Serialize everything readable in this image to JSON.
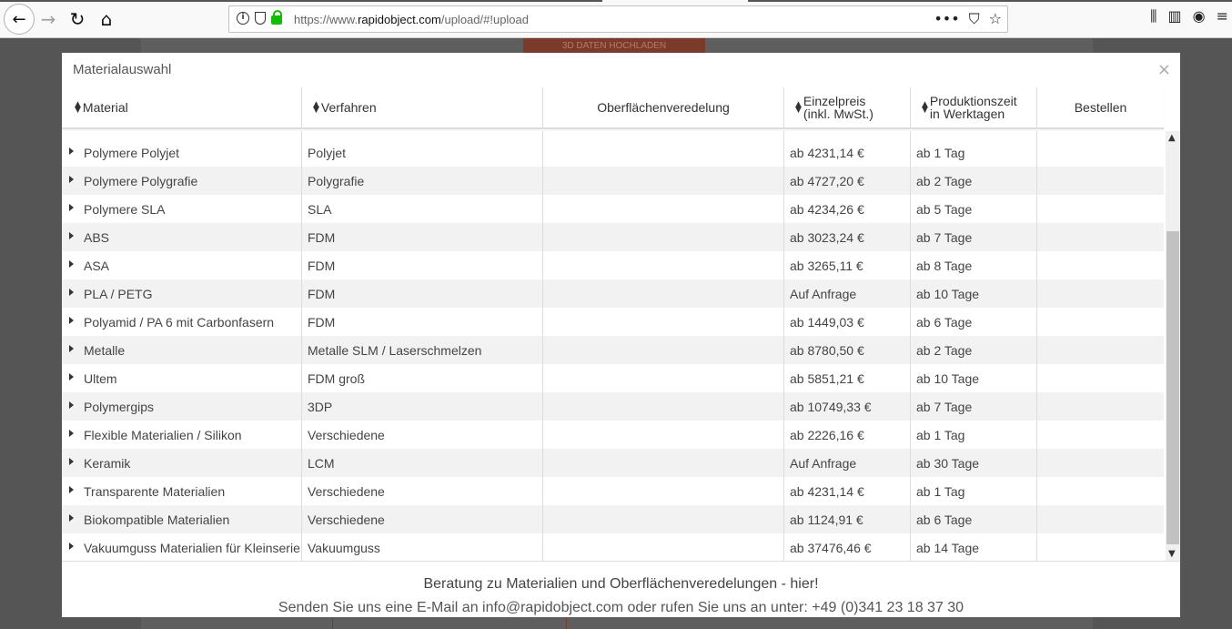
{
  "browser": {
    "url_prefix": "https://www.",
    "url_domain": "rapidobject.com",
    "url_path": "/upload/#!upload"
  },
  "background": {
    "upload_button": "3D DATEN HOCHLADEN"
  },
  "modal": {
    "title": "Materialauswahl",
    "close": "×"
  },
  "table": {
    "columns": {
      "material": "Material",
      "verfahren": "Verfahren",
      "oberflaeche": "Oberflächenveredelung",
      "einzelpreis_line1": "Einzelpreis",
      "einzelpreis_line2": "(inkl. MwSt.)",
      "produktion_line1": "Produktionszeit",
      "produktion_line2": "in Werktagen",
      "bestellen": "Bestellen"
    },
    "rows": [
      {
        "material": "Polymere Polyjet",
        "verfahren": "Polyjet",
        "preis": "ab 4231,14 €",
        "zeit": "ab 1 Tag"
      },
      {
        "material": "Polymere Polygrafie",
        "verfahren": "Polygrafie",
        "preis": "ab 4727,20 €",
        "zeit": "ab 2 Tage"
      },
      {
        "material": "Polymere SLA",
        "verfahren": "SLA",
        "preis": "ab 4234,26 €",
        "zeit": "ab 5 Tage"
      },
      {
        "material": "ABS",
        "verfahren": "FDM",
        "preis": "ab 3023,24 €",
        "zeit": "ab 7 Tage"
      },
      {
        "material": "ASA",
        "verfahren": "FDM",
        "preis": "ab 3265,11 €",
        "zeit": "ab 8 Tage"
      },
      {
        "material": "PLA / PETG",
        "verfahren": "FDM",
        "preis": "Auf Anfrage",
        "zeit": "ab 10 Tage"
      },
      {
        "material": "Polyamid / PA 6 mit Carbonfasern",
        "verfahren": "FDM",
        "preis": "ab 1449,03 €",
        "zeit": "ab 6 Tage"
      },
      {
        "material": "Metalle",
        "verfahren": "Metalle SLM / Laserschmelzen",
        "preis": "ab 8780,50 €",
        "zeit": "ab 2 Tage"
      },
      {
        "material": "Ultem",
        "verfahren": "FDM groß",
        "preis": "ab 5851,21 €",
        "zeit": "ab 10 Tage"
      },
      {
        "material": "Polymergips",
        "verfahren": "3DP",
        "preis": "ab 10749,33 €",
        "zeit": "ab 7 Tage"
      },
      {
        "material": "Flexible Materialien / Silikon",
        "verfahren": "Verschiedene",
        "preis": "ab 2226,16 €",
        "zeit": "ab 1 Tag"
      },
      {
        "material": "Keramik",
        "verfahren": "LCM",
        "preis": "Auf Anfrage",
        "zeit": "ab 30 Tage"
      },
      {
        "material": "Transparente Materialien",
        "verfahren": "Verschiedene",
        "preis": "ab 4231,14 €",
        "zeit": "ab 1 Tag"
      },
      {
        "material": "Biokompatible Materialien",
        "verfahren": "Verschiedene",
        "preis": "ab 1124,91 €",
        "zeit": "ab 6 Tage"
      },
      {
        "material": "Vakuumguss Materialien für Kleinserie",
        "verfahren": "Vakuumguss",
        "preis": "ab 37476,46 €",
        "zeit": "ab 14 Tage"
      }
    ]
  },
  "footer": {
    "title": "Beratung zu Materialien und Oberflächenveredelungen - hier!",
    "text": "Senden Sie uns eine E-Mail an info@rapidobject.com oder rufen Sie uns an unter: +49 (0)341 23 18 37 30"
  }
}
